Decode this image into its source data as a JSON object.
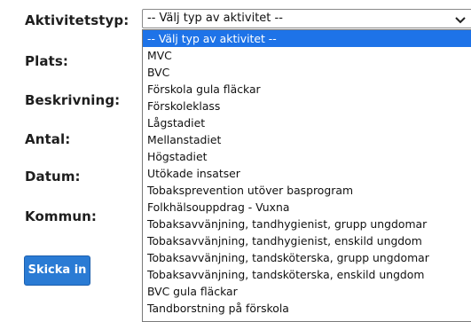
{
  "form": {
    "labels": {
      "activity_type": "Aktivitetstyp:",
      "place": "Plats:",
      "description": "Beskrivning:",
      "count": "Antal:",
      "date": "Datum:",
      "municipality": "Kommun:"
    },
    "activity_select": {
      "selected_value": "-- Välj typ av aktivitet --",
      "options": [
        "-- Välj typ av aktivitet --",
        "MVC",
        "BVC",
        "Förskola gula fläckar",
        "Förskoleklass",
        "Lågstadiet",
        "Mellanstadiet",
        "Högstadiet",
        "Utökade insatser",
        "Tobaksprevention utöver basprogram",
        "Folkhälsouppdrag - Vuxna",
        "Tobaksavvänjning, tandhygienist, grupp ungdomar",
        "Tobaksavvänjning, tandhygienist, enskild ungdom",
        "Tobaksavvänjning, tandsköterska, grupp ungdomar",
        "Tobaksavvänjning, tandsköterska, enskild ungdom",
        "BVC gula fläckar",
        "Tandborstning på förskola"
      ],
      "highlighted_index": 0,
      "chevron_icon": "chevron-down-icon"
    },
    "submit_label": "Skicka in"
  },
  "colors": {
    "highlight": "#1e73e8",
    "button": "#2a7bd4"
  }
}
